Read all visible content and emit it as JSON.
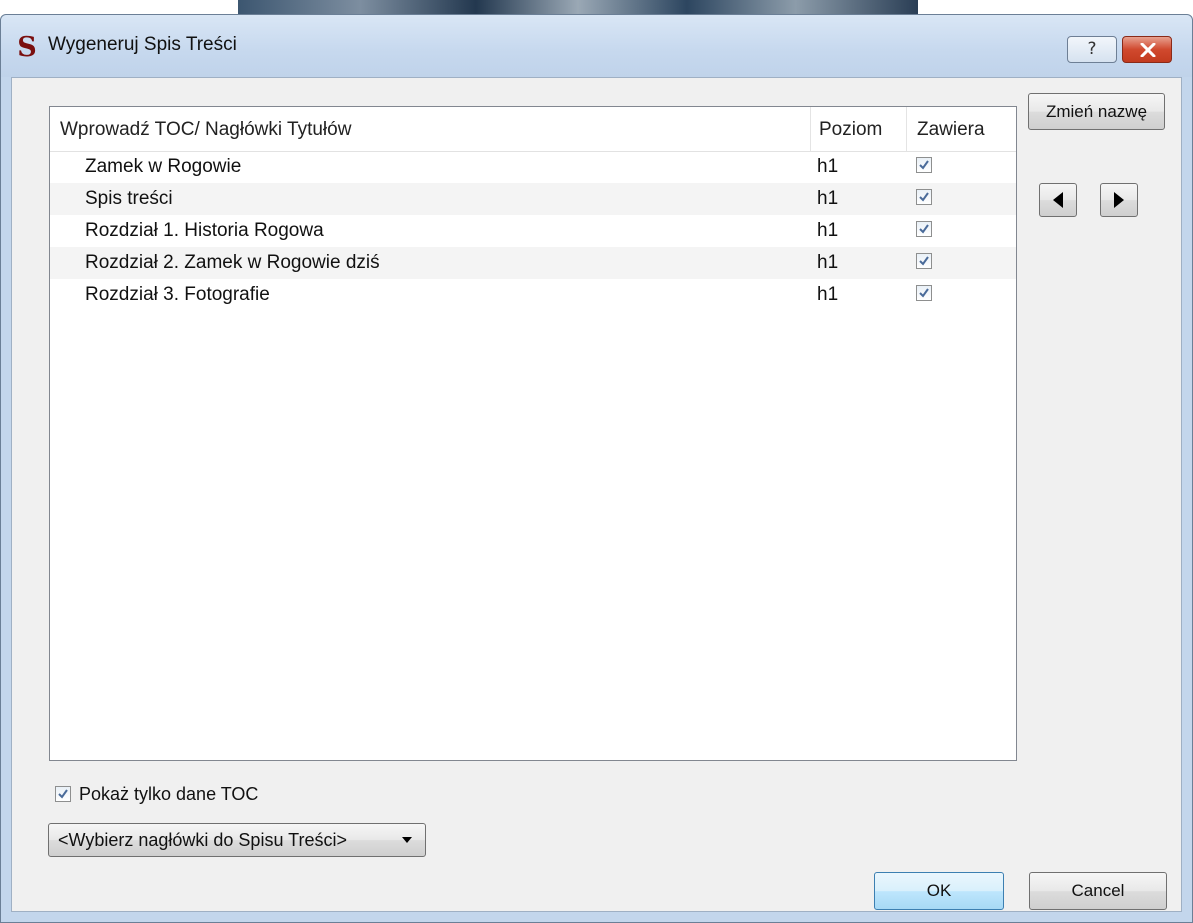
{
  "window": {
    "title": "Wygeneruj Spis Treści",
    "help_label": "?",
    "app_icon_glyph": "S"
  },
  "table": {
    "columns": [
      "Wprowadź TOC/ Nagłówki Tytułów",
      "Poziom",
      "Zawiera"
    ],
    "rows": [
      {
        "title": "Zamek w Rogowie",
        "level": "h1",
        "included": true
      },
      {
        "title": "Spis treści",
        "level": "h1",
        "included": true
      },
      {
        "title": "Rozdział 1. Historia Rogowa",
        "level": "h1",
        "included": true
      },
      {
        "title": "Rozdział 2. Zamek w Rogowie dziś",
        "level": "h1",
        "included": true
      },
      {
        "title": "Rozdział 3. Fotografie",
        "level": "h1",
        "included": true
      }
    ]
  },
  "sidebar": {
    "rename_label": "Zmień nazwę",
    "left_icon": "triangle-left-icon",
    "right_icon": "triangle-right-icon"
  },
  "options": {
    "toc_only_label": "Pokaż tylko dane TOC",
    "toc_only_checked": true,
    "heading_select_value": "<Wybierz nagłówki do Spisu Treści>"
  },
  "footer": {
    "ok_label": "OK",
    "cancel_label": "Cancel"
  },
  "colors": {
    "app_icon": "#7a0f0f",
    "close_button": "#c9452a",
    "dialog_frame": "#c3d6ec",
    "checkmark": "#4a6b9a"
  }
}
